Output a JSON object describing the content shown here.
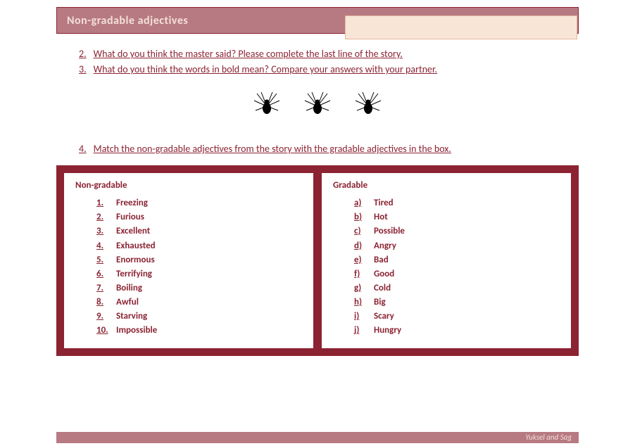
{
  "header": {
    "title": "Non-gradable  adjectives"
  },
  "questions": {
    "q2_num": "2.",
    "q2_text": "What do you think the master said? Please complete the last line of the story.",
    "q3_num": "3.",
    "q3_text": "What do you think the words in bold mean? Compare your answers with your partner.",
    "q4_num": "4.",
    "q4_text": "Match the non-gradable adjectives from the story with the gradable adjectives in the box."
  },
  "non_gradable": {
    "title": "Non-gradable",
    "items": [
      {
        "marker": "1.",
        "word": "Freezing"
      },
      {
        "marker": "2.",
        "word": "Furious"
      },
      {
        "marker": "3.",
        "word": "Excellent"
      },
      {
        "marker": "4.",
        "word": "Exhausted"
      },
      {
        "marker": "5.",
        "word": "Enormous"
      },
      {
        "marker": "6.",
        "word": "Terrifying"
      },
      {
        "marker": "7.",
        "word": "Boiling"
      },
      {
        "marker": "8.",
        "word": "Awful"
      },
      {
        "marker": "9.",
        "word": "Starving"
      },
      {
        "marker": "10.",
        "word": "Impossible"
      }
    ]
  },
  "gradable": {
    "title": "Gradable",
    "items": [
      {
        "marker": "a)",
        "word": "Tired"
      },
      {
        "marker": "b)",
        "word": "Hot"
      },
      {
        "marker": "c)",
        "word": "Possible"
      },
      {
        "marker": "d)",
        "word": "Angry"
      },
      {
        "marker": "e)",
        "word": "Bad"
      },
      {
        "marker": "f)",
        "word": "Good"
      },
      {
        "marker": "g)",
        "word": "Cold"
      },
      {
        "marker": "h)",
        "word": "Big"
      },
      {
        "marker": "i)",
        "word": "Scary"
      },
      {
        "marker": "j)",
        "word": "Hungry"
      }
    ]
  },
  "footer": {
    "text": "Yuksel and Sag"
  }
}
